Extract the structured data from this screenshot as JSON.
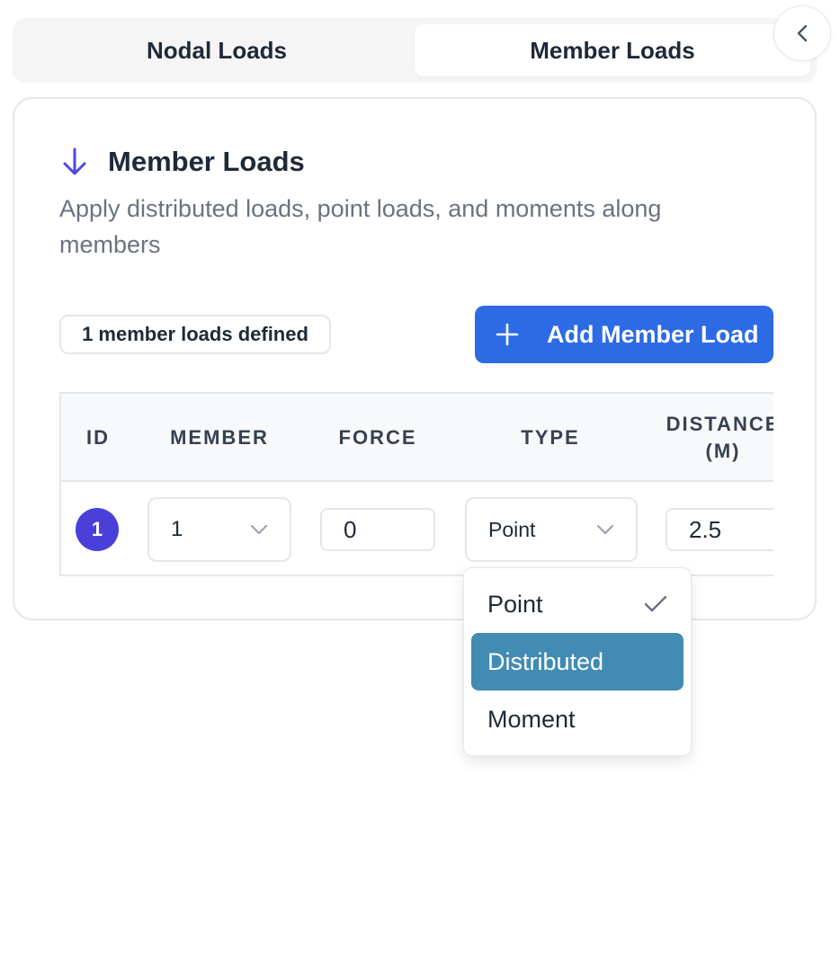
{
  "tabs": [
    {
      "label": "Nodal Loads",
      "active": false
    },
    {
      "label": "Member Loads",
      "active": true
    }
  ],
  "card": {
    "icon": "arrow-down-icon",
    "title": "Member Loads",
    "description": "Apply distributed loads, point loads, and moments along members",
    "count_badge": "1 member loads defined",
    "add_button": "Add Member Load"
  },
  "table": {
    "headers": {
      "id": "ID",
      "member": "MEMBER",
      "force": "FORCE",
      "type": "TYPE",
      "distance": "DISTANCE (M)"
    },
    "rows": [
      {
        "id": "1",
        "member": "1",
        "force": "0",
        "type": "Point",
        "distance": "2.5"
      }
    ]
  },
  "dropdown": {
    "options": [
      {
        "label": "Point",
        "selected": true
      },
      {
        "label": "Distributed",
        "highlighted": true
      },
      {
        "label": "Moment"
      }
    ]
  },
  "colors": {
    "accent": "#2d6be4",
    "id_badge": "#4a3fd9",
    "highlight": "#428bb3",
    "title_icon": "#4f46e5"
  }
}
